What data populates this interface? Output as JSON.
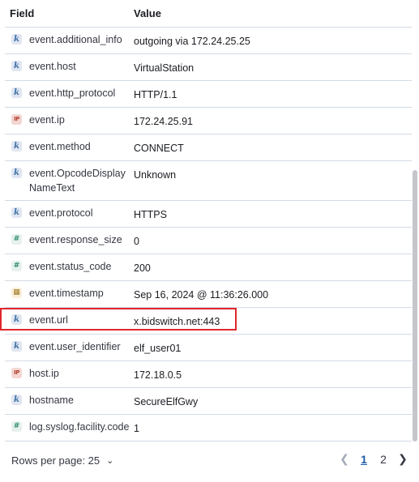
{
  "header": {
    "field": "Field",
    "value": "Value"
  },
  "rows": [
    {
      "type": "k",
      "icon": "keyword-type-icon",
      "field": "event.additional_info",
      "value": "outgoing via 172.24.25.25"
    },
    {
      "type": "k",
      "icon": "keyword-type-icon",
      "field": "event.host",
      "value": "VirtualStation"
    },
    {
      "type": "k",
      "icon": "keyword-type-icon",
      "field": "event.http_protocol",
      "value": "HTTP/1.1"
    },
    {
      "type": "ip",
      "icon": "ip-type-icon",
      "field": "event.ip",
      "value": "172.24.25.91"
    },
    {
      "type": "k",
      "icon": "keyword-type-icon",
      "field": "event.method",
      "value": "CONNECT"
    },
    {
      "type": "k",
      "icon": "keyword-type-icon",
      "field": "event.OpcodeDisplayNameText",
      "value": "Unknown"
    },
    {
      "type": "k",
      "icon": "keyword-type-icon",
      "field": "event.protocol",
      "value": "HTTPS"
    },
    {
      "type": "n",
      "icon": "number-type-icon",
      "field": "event.response_size",
      "value": "0"
    },
    {
      "type": "n",
      "icon": "number-type-icon",
      "field": "event.status_code",
      "value": "200"
    },
    {
      "type": "d",
      "icon": "date-type-icon",
      "field": "event.timestamp",
      "value": "Sep 16, 2024 @ 11:36:26.000"
    },
    {
      "type": "k",
      "icon": "keyword-type-icon",
      "field": "event.url",
      "value": "x.bidswitch.net:443",
      "highlighted": true
    },
    {
      "type": "k",
      "icon": "keyword-type-icon",
      "field": "event.user_identifier",
      "value": "elf_user01"
    },
    {
      "type": "ip",
      "icon": "ip-type-icon",
      "field": "host.ip",
      "value": "172.18.0.5"
    },
    {
      "type": "k",
      "icon": "keyword-type-icon",
      "field": "hostname",
      "value": "SecureElfGwy"
    },
    {
      "type": "n",
      "icon": "number-type-icon",
      "field": "log.syslog.facility.code",
      "value": "1"
    }
  ],
  "type_glyphs": {
    "k": "k",
    "n": "#",
    "ip": "IP",
    "d": "▦"
  },
  "footer": {
    "rows_per_page_label": "Rows per page: 25",
    "pages": [
      "1",
      "2"
    ],
    "current_page": "1"
  },
  "colors": {
    "highlight": "#e0262d",
    "active_page": "#1a5ba8"
  }
}
